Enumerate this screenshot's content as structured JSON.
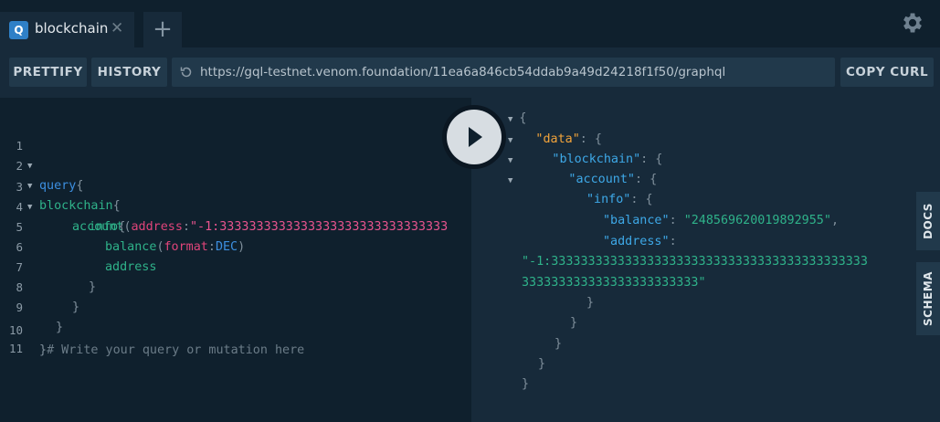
{
  "tabs": [
    {
      "badge": "Q",
      "title": "blockchain"
    }
  ],
  "toolbar": {
    "prettify": "PRETTIFY",
    "history": "HISTORY",
    "endpoint": "https://gql-testnet.venom.foundation/11ea6a846cb54ddab9a49d24218f1f50/graphql",
    "copy_curl": "COPY CURL"
  },
  "editor": {
    "line_numbers": [
      "1",
      "2",
      "3",
      "4",
      "5",
      "6",
      "7",
      "8",
      "9",
      "10",
      "11"
    ],
    "query_kw": "query",
    "blockchain": "blockchain",
    "account": "account",
    "address_arg": "address",
    "address_value": "\"-1:3333333333333333333333333333333",
    "info": "info",
    "balance": "balance",
    "format_arg": "format",
    "format_value": "DEC",
    "address_field": "address",
    "comment": "# Write your query or mutation here"
  },
  "result": {
    "data_key": "\"data\"",
    "blockchain_key": "\"blockchain\"",
    "account_key": "\"account\"",
    "info_key": "\"info\"",
    "balance_key": "\"balance\"",
    "balance_value": "\"248569620019892955\"",
    "address_key": "\"address\"",
    "address_value_1": "\"-1:3333333333333333333333333333333333333333333",
    "address_value_2": "333333333333333333333333\""
  },
  "side_tabs": {
    "docs": "DOCS",
    "schema": "SCHEMA"
  },
  "icons": {
    "settings": "gear-icon",
    "run": "play-icon",
    "reload": "reload-icon",
    "close": "close-icon",
    "add": "plus-icon"
  }
}
